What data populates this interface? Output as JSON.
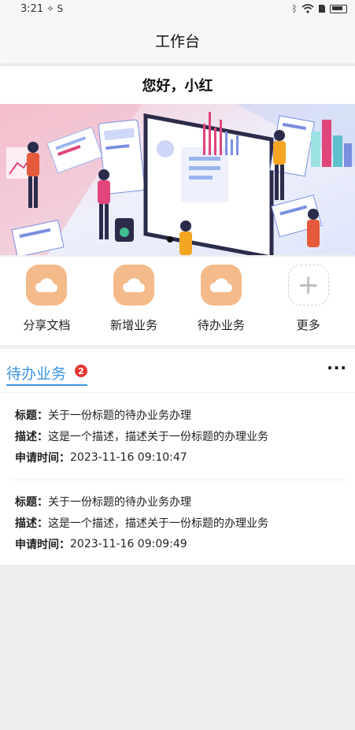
{
  "status_bar": {
    "time": "3:21",
    "icons": [
      "nfc-icon",
      "sync-icon",
      "bluetooth-icon",
      "wifi-icon",
      "sim-icon",
      "battery-icon"
    ]
  },
  "nav": {
    "title": "工作台"
  },
  "greeting": "您好，小红",
  "banner": {
    "page_indicator_index": 0
  },
  "quick_actions": [
    {
      "label": "分享文档",
      "icon": "cloud-icon"
    },
    {
      "label": "新增业务",
      "icon": "cloud-icon"
    },
    {
      "label": "待办业务",
      "icon": "cloud-icon"
    },
    {
      "label": "更多",
      "icon": "plus-icon"
    }
  ],
  "todo": {
    "title": "待办业务",
    "badge": "2",
    "more": "···",
    "labels": {
      "title": "标题：",
      "desc": "描述：",
      "time": "申请时间："
    },
    "items": [
      {
        "title": "关于一份标题的待办业务办理",
        "desc": "这是一个描述，描述关于一份标题的办理业务",
        "time": "2023-11-16 09:10:47"
      },
      {
        "title": "关于一份标题的待办业务办理",
        "desc": "这是一个描述，描述关于一份标题的办理业务",
        "time": "2023-11-16 09:09:49"
      }
    ]
  },
  "colors": {
    "accent": "#3b95e6",
    "icon_bg": "#f4ba8a",
    "badge": "#e53935"
  }
}
